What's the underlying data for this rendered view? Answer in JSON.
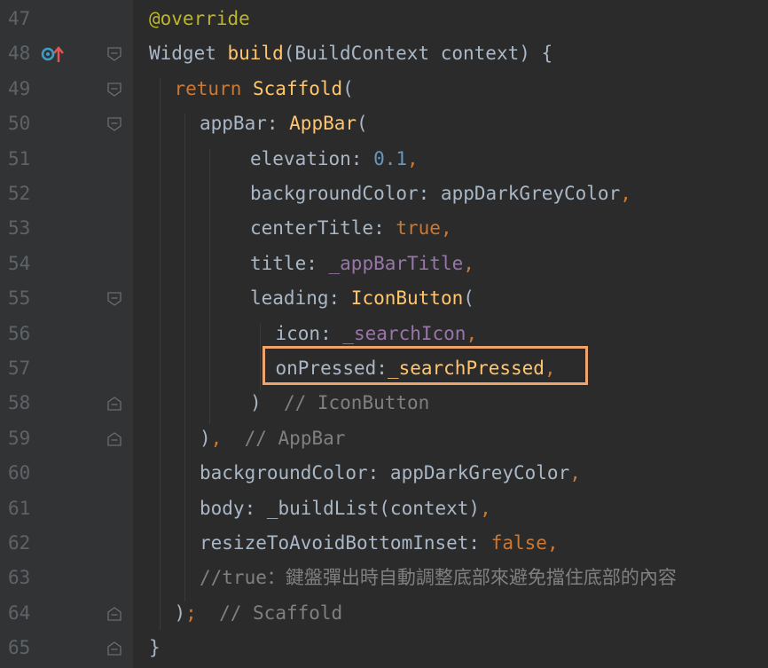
{
  "editor": {
    "lines": [
      {
        "num": "47",
        "fold": "",
        "gicon": false,
        "indent": 0,
        "tokens": [
          {
            "c": "ann",
            "t": "@override"
          }
        ]
      },
      {
        "num": "48",
        "fold": "open",
        "gicon": true,
        "indent": 0,
        "tokens": [
          {
            "c": "txt",
            "t": "Widget "
          },
          {
            "c": "fn",
            "t": "build"
          },
          {
            "c": "txt",
            "t": "(BuildContext context) {"
          }
        ]
      },
      {
        "num": "49",
        "fold": "open",
        "gicon": false,
        "indent": 1,
        "tokens": [
          {
            "c": "kw",
            "t": "return "
          },
          {
            "c": "fn",
            "t": "Scaffold"
          },
          {
            "c": "txt",
            "t": "("
          }
        ]
      },
      {
        "num": "50",
        "fold": "open",
        "gicon": false,
        "indent": 2,
        "tokens": [
          {
            "c": "txt",
            "t": "appBar: "
          },
          {
            "c": "fn",
            "t": "AppBar"
          },
          {
            "c": "txt",
            "t": "("
          }
        ]
      },
      {
        "num": "51",
        "fold": "",
        "gicon": false,
        "indent": 4,
        "tokens": [
          {
            "c": "txt",
            "t": "elevation: "
          },
          {
            "c": "num",
            "t": "0.1"
          },
          {
            "c": "kw",
            "t": ","
          }
        ]
      },
      {
        "num": "52",
        "fold": "",
        "gicon": false,
        "indent": 4,
        "tokens": [
          {
            "c": "txt",
            "t": "backgroundColor: appDarkGreyColor"
          },
          {
            "c": "kw",
            "t": ","
          }
        ]
      },
      {
        "num": "53",
        "fold": "",
        "gicon": false,
        "indent": 4,
        "tokens": [
          {
            "c": "txt",
            "t": "centerTitle: "
          },
          {
            "c": "kw",
            "t": "true,"
          }
        ]
      },
      {
        "num": "54",
        "fold": "",
        "gicon": false,
        "indent": 4,
        "tokens": [
          {
            "c": "txt",
            "t": "title: "
          },
          {
            "c": "field",
            "t": "_appBarTitle"
          },
          {
            "c": "kw",
            "t": ","
          }
        ]
      },
      {
        "num": "55",
        "fold": "open",
        "gicon": false,
        "indent": 4,
        "tokens": [
          {
            "c": "txt",
            "t": "leading: "
          },
          {
            "c": "fn",
            "t": "IconButton"
          },
          {
            "c": "txt",
            "t": "("
          }
        ]
      },
      {
        "num": "56",
        "fold": "",
        "gicon": false,
        "indent": 5,
        "tokens": [
          {
            "c": "txt",
            "t": "icon: "
          },
          {
            "c": "field",
            "t": "_searchIcon"
          },
          {
            "c": "kw",
            "t": ","
          }
        ]
      },
      {
        "num": "57",
        "fold": "",
        "gicon": false,
        "indent": 5,
        "tokens": [
          {
            "c": "txt",
            "t": "onPressed:"
          },
          {
            "c": "fn",
            "t": "_searchPressed"
          },
          {
            "c": "kw",
            "t": ","
          }
        ]
      },
      {
        "num": "58",
        "fold": "close",
        "gicon": false,
        "indent": 4,
        "tokens": [
          {
            "c": "txt",
            "t": ")  "
          },
          {
            "c": "cmt",
            "t": "// IconButton"
          }
        ]
      },
      {
        "num": "59",
        "fold": "close",
        "gicon": false,
        "indent": 2,
        "tokens": [
          {
            "c": "txt",
            "t": ")"
          },
          {
            "c": "kw",
            "t": ","
          },
          {
            "c": "txt",
            "t": "  "
          },
          {
            "c": "cmt",
            "t": "// AppBar"
          }
        ]
      },
      {
        "num": "60",
        "fold": "",
        "gicon": false,
        "indent": 2,
        "tokens": [
          {
            "c": "txt",
            "t": "backgroundColor: appDarkGreyColor"
          },
          {
            "c": "kw",
            "t": ","
          }
        ]
      },
      {
        "num": "61",
        "fold": "",
        "gicon": false,
        "indent": 2,
        "tokens": [
          {
            "c": "txt",
            "t": "body: _buildList(context)"
          },
          {
            "c": "kw",
            "t": ","
          }
        ]
      },
      {
        "num": "62",
        "fold": "",
        "gicon": false,
        "indent": 2,
        "tokens": [
          {
            "c": "txt",
            "t": "resizeToAvoidBottomInset: "
          },
          {
            "c": "kw",
            "t": "false,"
          }
        ]
      },
      {
        "num": "63",
        "fold": "",
        "gicon": false,
        "indent": 2,
        "tokens": [
          {
            "c": "cmt",
            "t": "//true：鍵盤彈出時自動調整底部來避免擋住底部的內容"
          }
        ]
      },
      {
        "num": "64",
        "fold": "close",
        "gicon": false,
        "indent": 1,
        "tokens": [
          {
            "c": "txt",
            "t": ")"
          },
          {
            "c": "kw",
            "t": ";"
          },
          {
            "c": "txt",
            "t": "  "
          },
          {
            "c": "cmt",
            "t": "// Scaffold"
          }
        ]
      },
      {
        "num": "65",
        "fold": "close",
        "gicon": false,
        "indent": 0,
        "tokens": [
          {
            "c": "txt",
            "t": "}"
          }
        ]
      }
    ]
  },
  "colors": {
    "background": "#2b2b2b",
    "gutter": "#313335",
    "highlight_border": "#f0a36c"
  },
  "icons": {
    "gutter_line_48": "override-method-icon"
  }
}
